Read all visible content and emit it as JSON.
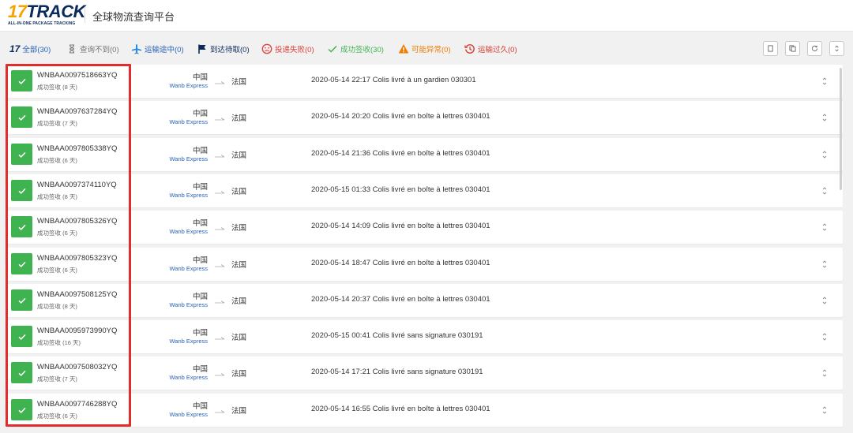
{
  "header": {
    "logo_main_prefix": "17",
    "logo_main_suffix": "TRACK",
    "logo_sub": "ALL-IN-ONE PACKAGE TRACKING",
    "platform_title": "全球物流查询平台"
  },
  "filters": [
    {
      "label": "全部(30)",
      "icon": "17track-logo",
      "color": "#2a62b8"
    },
    {
      "label": "查询不到(0)",
      "icon": "hourglass-icon",
      "color": "#777777"
    },
    {
      "label": "运输途中(0)",
      "icon": "airplane-icon",
      "color": "#2a62b8"
    },
    {
      "label": "到达待取(0)",
      "icon": "flag-icon",
      "color": "#0b2a5c"
    },
    {
      "label": "投递失败(0)",
      "icon": "sad-face-icon",
      "color": "#e0413a"
    },
    {
      "label": "成功签收(30)",
      "icon": "check-icon",
      "color": "#3fb34f"
    },
    {
      "label": "可能异常(0)",
      "icon": "warning-icon",
      "color": "#f07c00"
    },
    {
      "label": "运输过久(0)",
      "icon": "clock-history-icon",
      "color": "#d63a2f"
    }
  ],
  "toolbar": [
    "copy-icon",
    "duplicate-icon",
    "refresh-icon",
    "expand-all-icon"
  ],
  "colors": {
    "success": "#3fb34f",
    "highlight": "#e22d2d",
    "link": "#2a62b8",
    "brand_navy": "#0b2a5c",
    "brand_orange": "#f5a300"
  },
  "rows": [
    {
      "tracking": "WNBAA0097518663YQ",
      "status": "成功签收 (8 天)",
      "origin": "中国",
      "carrier": "Wanb Express",
      "dest": "法国",
      "event": "2020-05-14 22:17  Colis livré à un gardien 030301"
    },
    {
      "tracking": "WNBAA0097637284YQ",
      "status": "成功签收 (7 天)",
      "origin": "中国",
      "carrier": "Wanb Express",
      "dest": "法国",
      "event": "2020-05-14 20:20  Colis livré en boîte à lettres 030401"
    },
    {
      "tracking": "WNBAA0097805338YQ",
      "status": "成功签收 (6 天)",
      "origin": "中国",
      "carrier": "Wanb Express",
      "dest": "法国",
      "event": "2020-05-14 21:36  Colis livré en boîte à lettres 030401"
    },
    {
      "tracking": "WNBAA0097374110YQ",
      "status": "成功签收 (8 天)",
      "origin": "中国",
      "carrier": "Wanb Express",
      "dest": "法国",
      "event": "2020-05-15 01:33  Colis livré en boîte à lettres 030401"
    },
    {
      "tracking": "WNBAA0097805326YQ",
      "status": "成功签收 (6 天)",
      "origin": "中国",
      "carrier": "Wanb Express",
      "dest": "法国",
      "event": "2020-05-14 14:09  Colis livré en boîte à lettres 030401"
    },
    {
      "tracking": "WNBAA0097805323YQ",
      "status": "成功签收 (6 天)",
      "origin": "中国",
      "carrier": "Wanb Express",
      "dest": "法国",
      "event": "2020-05-14 18:47  Colis livré en boîte à lettres 030401"
    },
    {
      "tracking": "WNBAA0097508125YQ",
      "status": "成功签收 (8 天)",
      "origin": "中国",
      "carrier": "Wanb Express",
      "dest": "法国",
      "event": "2020-05-14 20:37  Colis livré en boîte à lettres 030401"
    },
    {
      "tracking": "WNBAA0095973990YQ",
      "status": "成功签收 (16 天)",
      "origin": "中国",
      "carrier": "Wanb Express",
      "dest": "法国",
      "event": "2020-05-15 00:41  Colis livré sans signature 030191"
    },
    {
      "tracking": "WNBAA0097508032YQ",
      "status": "成功签收 (7 天)",
      "origin": "中国",
      "carrier": "Wanb Express",
      "dest": "法国",
      "event": "2020-05-14 17:21  Colis livré sans signature 030191"
    },
    {
      "tracking": "WNBAA0097746288YQ",
      "status": "成功签收 (6 天)",
      "origin": "中国",
      "carrier": "Wanb Express",
      "dest": "法国",
      "event": "2020-05-14 16:55  Colis livré en boîte à lettres 030401"
    }
  ]
}
